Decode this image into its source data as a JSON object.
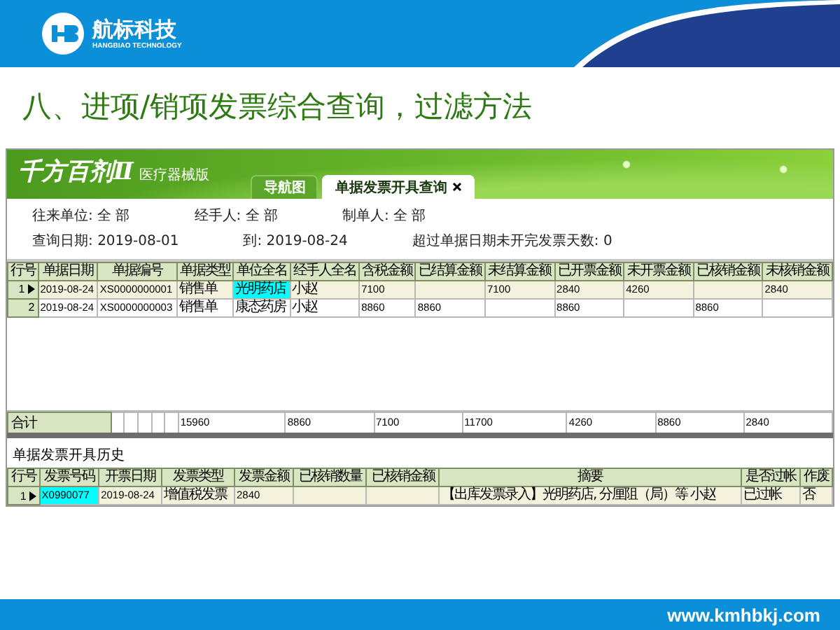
{
  "header": {
    "brand": "航标科技",
    "brand_en": "HANGBIAO TECHNOLOGY"
  },
  "title": "八、进项/销项发票综合查询，过滤方法",
  "app": {
    "product": "千方百剂Ⅱ",
    "edition": "医疗器械版",
    "tabs": [
      {
        "label": "导航图",
        "selected": false,
        "closable": false
      },
      {
        "label": "单据发票开具查询",
        "selected": true,
        "closable": true
      }
    ],
    "filters": [
      [
        {
          "label": "往来单位:",
          "value": "全 部"
        },
        {
          "label": "经手人:",
          "value": "全 部"
        },
        {
          "label": "制单人:",
          "value": "全 部"
        }
      ],
      [
        {
          "label": "查询日期:",
          "value": "2019-08-01"
        },
        {
          "label": "到:",
          "value": "2019-08-24"
        },
        {
          "label": "超过单据日期未开完发票天数:",
          "value": "0"
        }
      ]
    ],
    "grid": {
      "columns": [
        "行号",
        "单据日期",
        "单据编号",
        "单据类型",
        "单位全名",
        "经手人全名",
        "含税金额",
        "已结算金额",
        "未结算金额",
        "已开票金额",
        "未开票金额",
        "已核销金额",
        "未核销金额"
      ],
      "rows": [
        {
          "selected": true,
          "cells": [
            {
              "text": "1"
            },
            {
              "text": "2019-08-24",
              "focused": false
            },
            {
              "text": "XS0000000001",
              "focused": false
            },
            {
              "text": "销售单",
              "focused": false
            },
            {
              "text": "光明药店",
              "focused": true
            },
            {
              "text": "小赵",
              "focused": false
            },
            {
              "text": "7100",
              "focused": false
            },
            null,
            {
              "text": "7100",
              "focused": false
            },
            {
              "text": "2840",
              "focused": false
            },
            {
              "text": "4260",
              "focused": false
            },
            null,
            {
              "text": "2840",
              "focused": false
            }
          ]
        },
        {
          "selected": false,
          "cells": [
            {
              "text": "2"
            },
            {
              "text": "2019-08-24",
              "focused": false
            },
            {
              "text": "XS0000000003",
              "focused": false
            },
            {
              "text": "销售单",
              "focused": false
            },
            {
              "text": "康态药房",
              "focused": false
            },
            {
              "text": "小赵",
              "focused": false
            },
            {
              "text": "8860",
              "focused": false
            },
            {
              "text": "8860",
              "focused": false
            },
            null,
            {
              "text": "8860",
              "focused": false
            },
            null,
            {
              "text": "8860",
              "focused": false
            },
            null
          ]
        }
      ],
      "totals": {
        "cells": [
          "合计",
          null,
          null,
          null,
          null,
          null,
          "15960",
          "8860",
          "7100",
          "11700",
          "4260",
          "8860",
          "2840"
        ]
      }
    },
    "history": {
      "title": "单据发票开具历史",
      "columns": [
        "行号",
        "发票号码",
        "开票日期",
        "发票类型",
        "发票金额",
        "已核销数量",
        "已核销金额",
        "摘要",
        "是否过帐",
        "作废"
      ],
      "rows": [
        {
          "selected": true,
          "cells": [
            {
              "text": "1"
            },
            {
              "text": "X0990077",
              "focused": true
            },
            {
              "text": "2019-08-24",
              "focused": false
            },
            {
              "text": "增值税发票",
              "focused": false
            },
            {
              "text": "2840",
              "focused": false
            },
            null,
            null,
            {
              "text": "【出库发票录入】光明药店, 分厘阻（局）等 小赵",
              "focused": false
            },
            {
              "text": "已过帐",
              "focused": false
            },
            {
              "text": "否",
              "focused": false
            }
          ]
        }
      ]
    }
  },
  "footer": {
    "url": "www.kmhbkj.com"
  }
}
